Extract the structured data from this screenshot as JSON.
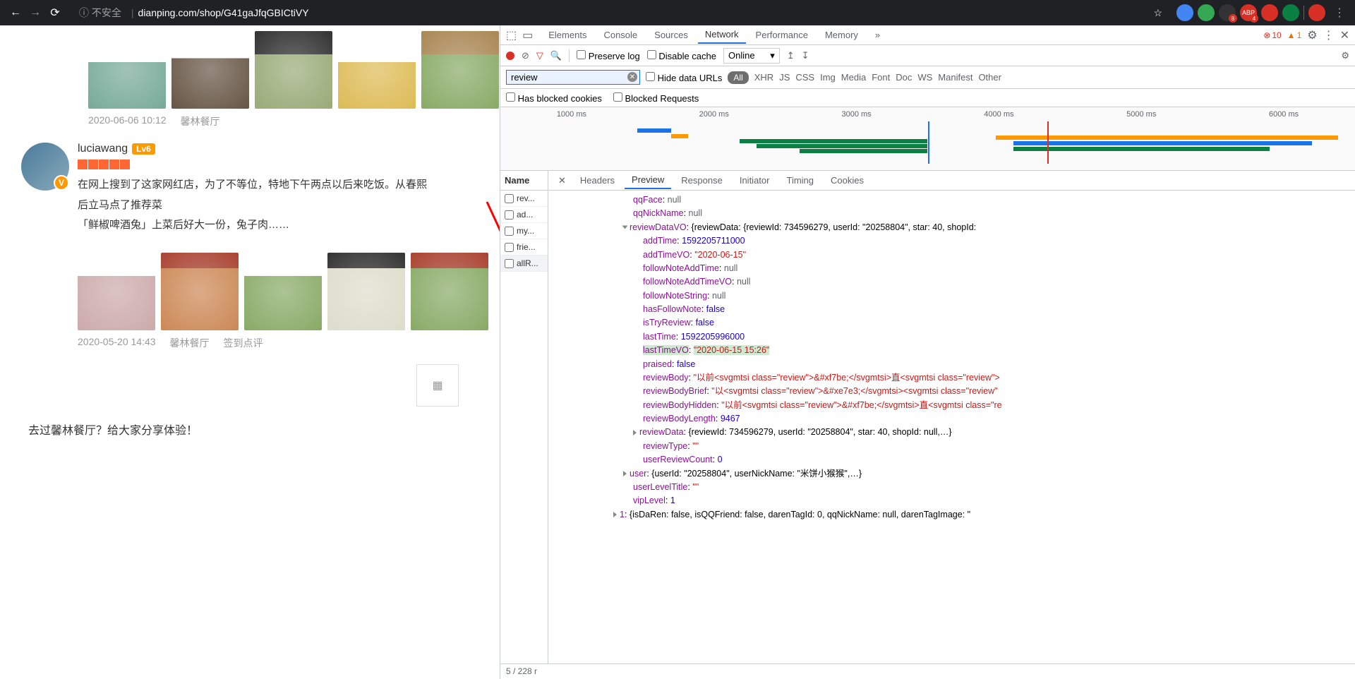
{
  "browser": {
    "insecure_label": "ⓘ 不安全",
    "url": "dianping.com/shop/G41gaJfqGBICtiVY",
    "ext_badges": {
      "adblock": "8",
      "other": "4"
    }
  },
  "page": {
    "review1": {
      "date": "2020-06-06 10:12",
      "restaurant": "馨林餐厅"
    },
    "review2": {
      "username": "luciawang",
      "level": "Lv6",
      "vbadge": "V",
      "text_line1": "在网上搜到了这家网红店，为了不等位，特地下午两点以后来吃饭。从春熙",
      "text_line2": "后立马点了推荐菜",
      "text_line3": "「鲜椒啤酒兔」上菜后好大一份，兔子肉……",
      "date": "2020-05-20 14:43",
      "restaurant": "馨林餐厅",
      "sign": "签到点评"
    },
    "share_prompt": "去过馨林餐厅？给大家分享体验！"
  },
  "devtools": {
    "tabs": [
      "Elements",
      "Console",
      "Sources",
      "Network",
      "Performance",
      "Memory"
    ],
    "active_tab": "Network",
    "more": "»",
    "errors": "10",
    "warnings": "1",
    "toolbar": {
      "preserve_log": "Preserve log",
      "disable_cache": "Disable cache",
      "online": "Online"
    },
    "filter": {
      "value": "review",
      "hide_urls": "Hide data URLs",
      "types": [
        "All",
        "XHR",
        "JS",
        "CSS",
        "Img",
        "Media",
        "Font",
        "Doc",
        "WS",
        "Manifest",
        "Other"
      ],
      "blocked_cookies": "Has blocked cookies",
      "blocked_requests": "Blocked Requests"
    },
    "timeline_labels": [
      "1000 ms",
      "2000 ms",
      "3000 ms",
      "4000 ms",
      "5000 ms",
      "6000 ms"
    ],
    "request_list": {
      "header": "Name",
      "items": [
        "rev...",
        "ad...",
        "my...",
        "frie...",
        "allR..."
      ]
    },
    "detail_tabs": [
      "Headers",
      "Preview",
      "Response",
      "Initiator",
      "Timing",
      "Cookies"
    ],
    "active_detail": "Preview",
    "status": "5 / 228 r",
    "json": {
      "qqFace": "null",
      "qqNickName": "null",
      "reviewDataVO_prefix": "reviewDataVO",
      "reviewDataVO_val": "{reviewData: {reviewId: 734596279, userId: \"20258804\", star: 40, shopId:",
      "addTime": "1592205711000",
      "addTimeVO": "\"2020-06-15\"",
      "followNoteAddTime": "null",
      "followNoteAddTimeVO": "null",
      "followNoteString": "null",
      "hasFollowNote": "false",
      "isTryReview": "false",
      "lastTime": "1592205996000",
      "lastTimeVO": "\"2020-06-15 15:26\"",
      "praised": "false",
      "reviewBody": "\"以前<svgmtsi class=\"review\">&#xf7be;</svgmtsi>直<svgmtsi class=\"review\">",
      "reviewBodyBrief": "\"以<svgmtsi class=\"review\">&#xe7e3;</svgmtsi><svgmtsi class=\"review\"",
      "reviewBodyHidden": "\"以前<svgmtsi class=\"review\">&#xf7be;</svgmtsi>直<svgmtsi class=\"re",
      "reviewBodyLength": "9467",
      "reviewData": "{reviewId: 734596279, userId: \"20258804\", star: 40, shopId: null,…}",
      "reviewType": "\"\"",
      "userReviewCount": "0",
      "user": "{userId: \"20258804\", userNickName: \"米饼小猴猴\",…}",
      "userLevelTitle": "\"\"",
      "vipLevel": "1",
      "idx1": "{isDaRen: false, isQQFriend: false, darenTagId: 0, qqNickName: null, darenTagImage: \""
    }
  }
}
